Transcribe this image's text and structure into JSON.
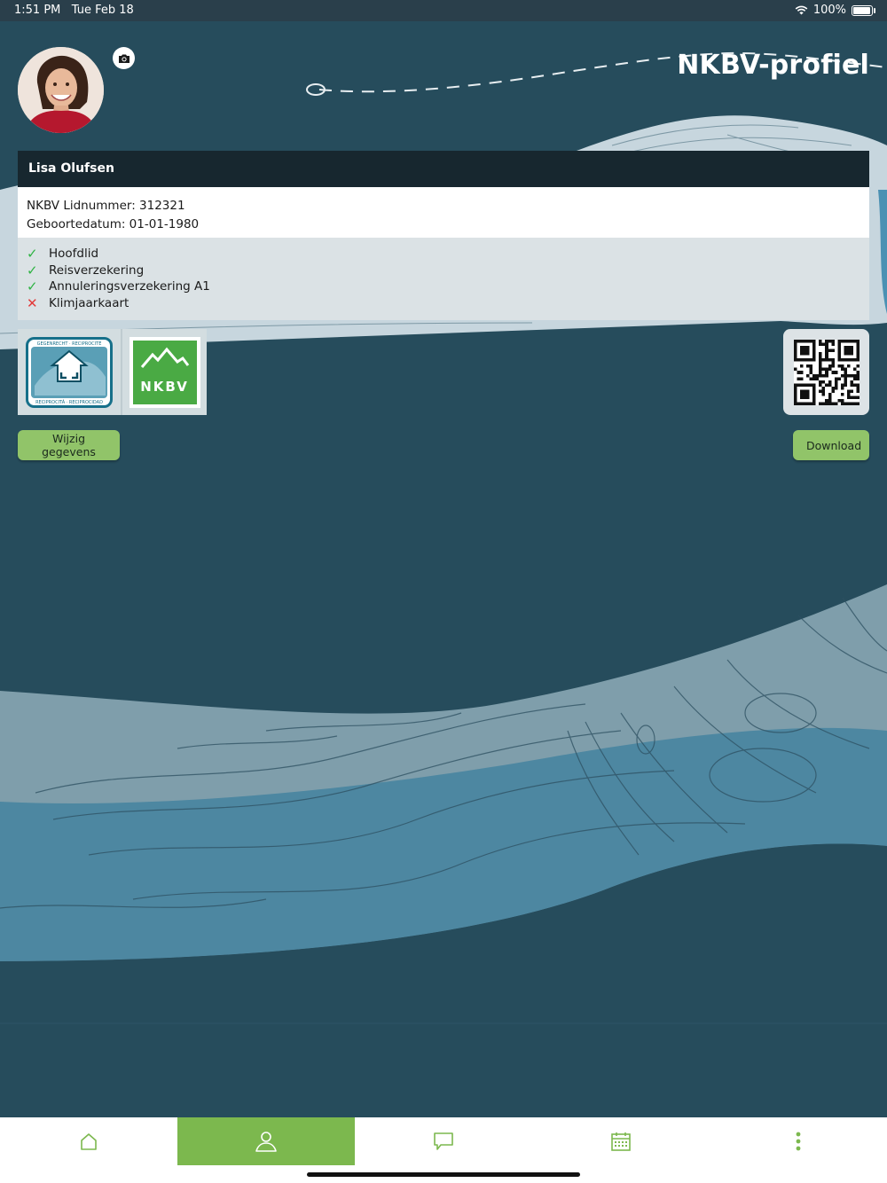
{
  "status_bar": {
    "time": "1:51 PM",
    "date": "Tue Feb 18",
    "battery": "100%",
    "battery_level": 1.0
  },
  "header": {
    "title": "NKBV-profiel"
  },
  "profile": {
    "name": "Lisa Olufsen",
    "member_number": "NKBV Lidnummer: 312321",
    "birthdate": "Geboortedatum: 01-01-1980",
    "memberships": [
      {
        "label": "Hoofdlid",
        "active": true
      },
      {
        "label": "Reisverzekering",
        "active": true
      },
      {
        "label": "Annuleringsverzekering A1",
        "active": true
      },
      {
        "label": "Klimjaarkaart",
        "active": false
      }
    ]
  },
  "logos": {
    "reciprocity_top": "GEGENRECHT · RECIPROCITÉ",
    "reciprocity_bottom": "RECIPROCITÀ · RECIPROCIDAD",
    "nkbv": "NKBV"
  },
  "buttons": {
    "edit": "Wijzig gegevens",
    "download": "Download"
  },
  "tabs": [
    {
      "name": "home-icon",
      "active": false
    },
    {
      "name": "profile-icon",
      "active": true
    },
    {
      "name": "chat-icon",
      "active": false
    },
    {
      "name": "calendar-icon",
      "active": false
    },
    {
      "name": "more-icon",
      "active": false
    }
  ],
  "colors": {
    "background": "#264c5c",
    "accent_green": "#7cb84e",
    "button_green": "#91c469",
    "check": "#2fb344",
    "cross": "#e23a3a"
  }
}
